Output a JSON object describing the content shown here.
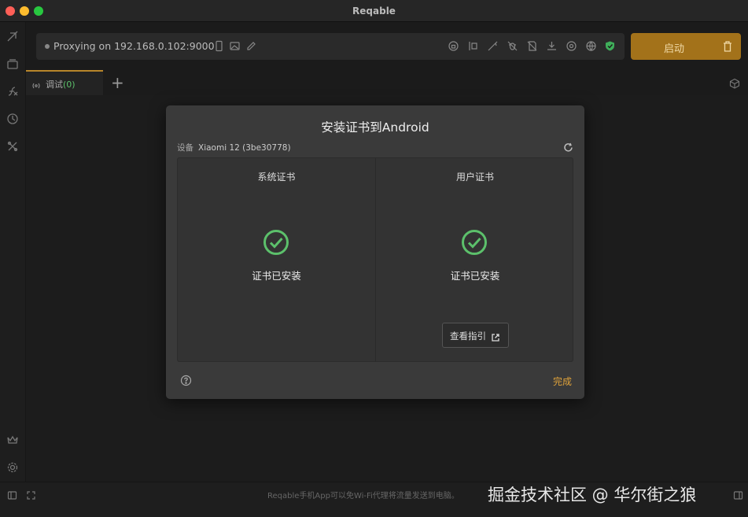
{
  "window": {
    "title": "Reqable"
  },
  "toolbar": {
    "proxy_status": "Proxying on 192.168.0.102:9000",
    "icons": [
      "phone-icon",
      "image-icon",
      "pencil-icon",
      "lock-icon",
      "breakpoint-icon",
      "no-rewrite-icon",
      "no-bug-icon",
      "script-icon",
      "download-icon",
      "at-icon",
      "globe-icon",
      "shield-icon"
    ],
    "start_label": "启动"
  },
  "tabs": [
    {
      "label": "调试",
      "count": "(0)"
    }
  ],
  "dialog": {
    "title": "安装证书到Android",
    "device_label": "设备",
    "device_name": "Xiaomi 12 (3be30778)",
    "system_cert": {
      "title": "系统证书",
      "status": "证书已安装"
    },
    "user_cert": {
      "title": "用户证书",
      "status": "证书已安装",
      "guide_label": "查看指引"
    },
    "done_label": "完成"
  },
  "statusbar": {
    "tip": "Reqable手机App可以免Wi-Fi代理将流量发送到电脑。",
    "watermark": "掘金技术社区 @ 华尔街之狼"
  },
  "colors": {
    "accent": "#a3721a",
    "success": "#5cc06b",
    "done": "#e0a33a"
  }
}
